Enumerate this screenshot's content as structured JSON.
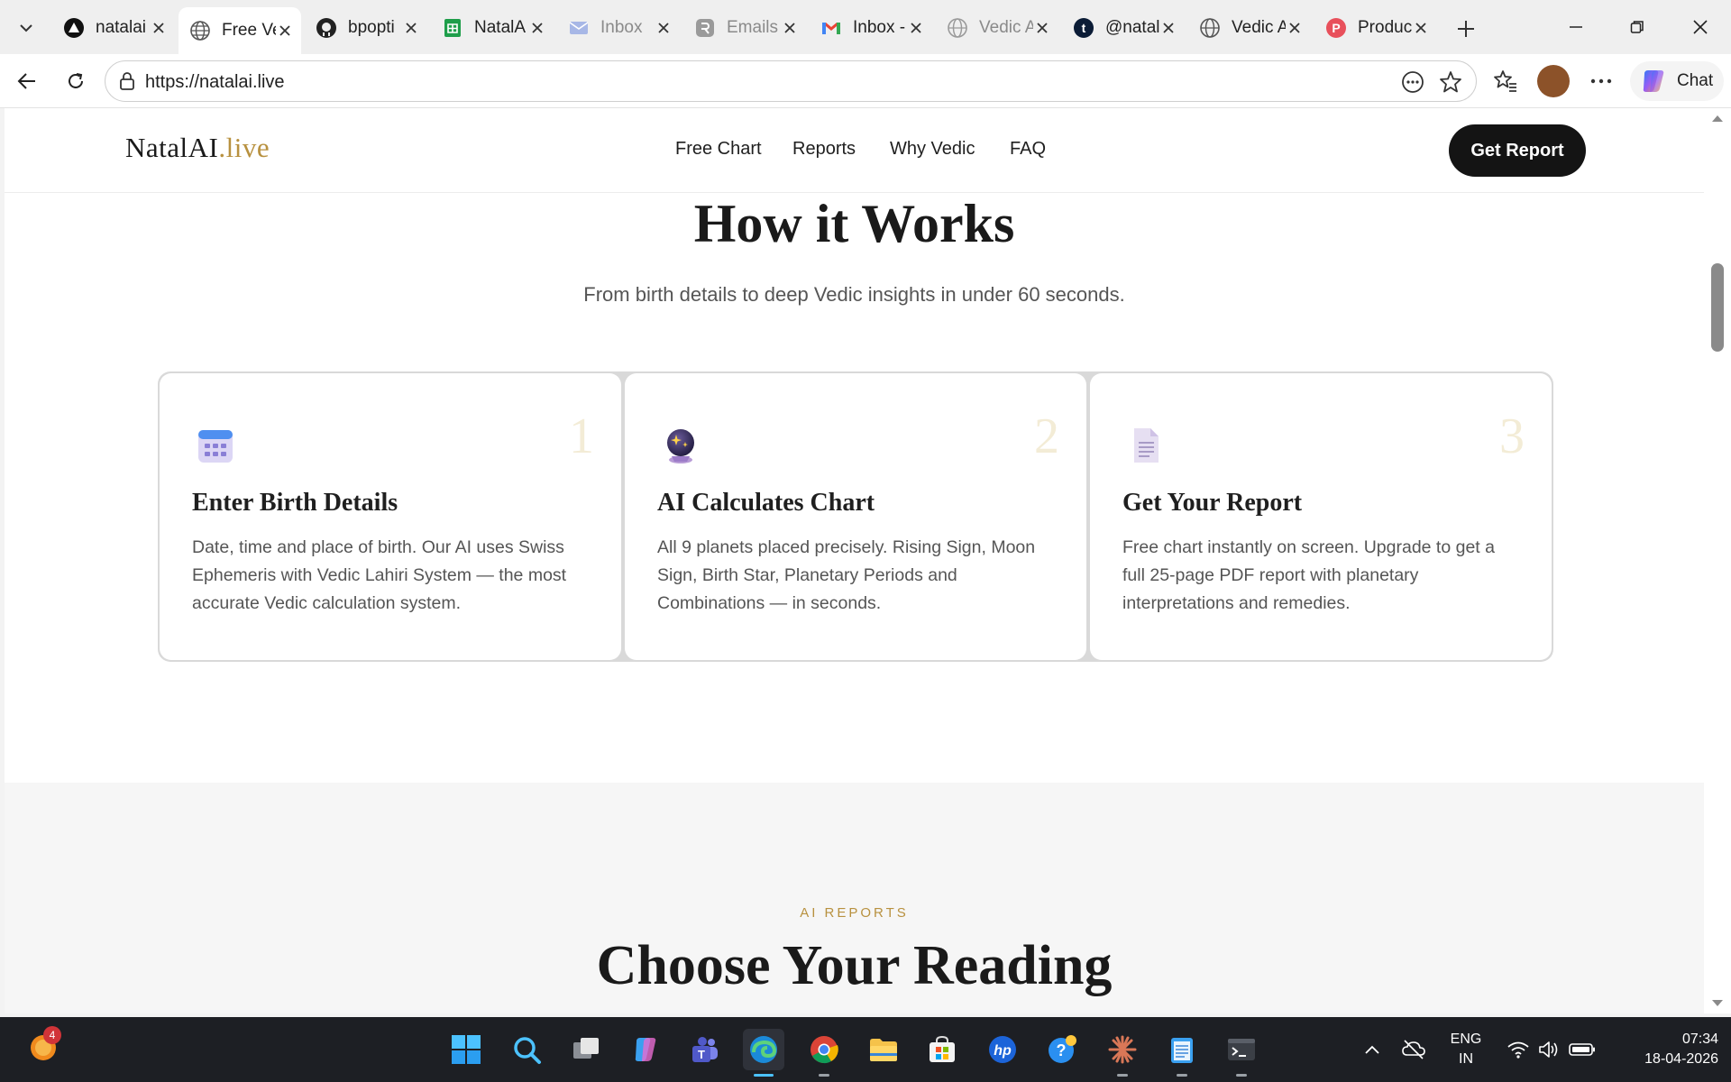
{
  "browser": {
    "tabs": [
      {
        "label": "natalai",
        "icon": "vercel-triangle-icon",
        "state": "normal"
      },
      {
        "label": "Free Ve",
        "icon": "globe-icon",
        "state": "active"
      },
      {
        "label": "bpopti",
        "icon": "github-icon",
        "state": "normal"
      },
      {
        "label": "NatalA",
        "icon": "google-sheets-icon",
        "state": "normal"
      },
      {
        "label": "Inbox",
        "icon": "mail-icon",
        "state": "dim"
      },
      {
        "label": "Emails",
        "icon": "resend-icon",
        "state": "dim"
      },
      {
        "label": "Inbox -",
        "icon": "gmail-icon",
        "state": "normal"
      },
      {
        "label": "Vedic A",
        "icon": "globe-icon",
        "state": "dim"
      },
      {
        "label": "@natal",
        "icon": "tumblr-icon",
        "state": "normal"
      },
      {
        "label": "Vedic A",
        "icon": "globe-icon",
        "state": "normal"
      },
      {
        "label": "Produc",
        "icon": "producthunt-icon",
        "state": "normal"
      }
    ],
    "address": "https://natalai.live",
    "chat_label": "Chat"
  },
  "site": {
    "logo_main": "NatalAI",
    "logo_accent": ".live",
    "nav": [
      "Free Chart",
      "Reports",
      "Why Vedic",
      "FAQ"
    ],
    "cta": "Get Report",
    "how": {
      "title": "How it Works",
      "subtitle": "From birth details to deep Vedic insights in under 60 seconds.",
      "steps": [
        {
          "num": "1",
          "icon": "calendar-icon",
          "title": "Enter Birth Details",
          "desc": "Date, time and place of birth. Our AI uses Swiss Ephemeris with Vedic Lahiri System — the most accurate Vedic calculation system."
        },
        {
          "num": "2",
          "icon": "crystal-ball-icon",
          "title": "AI Calculates Chart",
          "desc": "All 9 planets placed precisely. Rising Sign, Moon Sign, Birth Star, Planetary Periods and Combinations — in seconds."
        },
        {
          "num": "3",
          "icon": "document-icon",
          "title": "Get Your Report",
          "desc": "Free chart instantly on screen. Upgrade to get a full 25-page PDF report with planetary interpretations and remedies."
        }
      ]
    },
    "reports": {
      "eyebrow": "AI REPORTS",
      "title": "Choose Your Reading"
    }
  },
  "taskbar": {
    "notification_count": "4",
    "lang_top": "ENG",
    "lang_bottom": "IN",
    "time": "07:34",
    "date": "18-04-2026"
  },
  "colors": {
    "accent_gold": "#b8913f",
    "cta_bg": "#141414",
    "taskbar_bg": "#1d1f24"
  }
}
